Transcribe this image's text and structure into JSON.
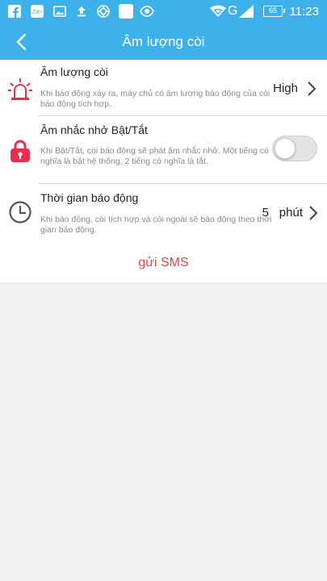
{
  "statusbar": {
    "time": "11:23",
    "battery": "65",
    "network": "G",
    "icons": [
      "facebook-icon",
      "zalo-icon",
      "image-icon",
      "upload-icon",
      "app-icon",
      "square-icon",
      "eye-icon",
      "wifi-icon",
      "signal-icon",
      "battery-icon"
    ]
  },
  "appbar": {
    "title": "Âm lượng còi",
    "back_icon": "back-arrow-icon"
  },
  "settings": {
    "volume": {
      "title": "Âm lượng còi",
      "description": "Khi báo động xảy ra, máy chủ có âm lượng báo động của còi báo động tích hợp.",
      "value": "High",
      "icon": "siren-icon"
    },
    "reminder": {
      "title": "Âm nhắc nhở Bật/Tắt",
      "description": "Khi Bật/Tắt, còi báo động sẽ phát âm nhắc nhở. Một tiếng có nghĩa là bật hệ thống, 2 tiếng có nghĩa là tắt.",
      "enabled": false,
      "icon": "lock-icon"
    },
    "alarm_time": {
      "title": "Thời gian báo động",
      "description": "Khi báo động, còi tích hợp và còi ngoài sẽ báo động theo thời gian báo động.",
      "value": "5",
      "unit": "phút",
      "icon": "clock-icon"
    }
  },
  "sms_label": "gửi SMS",
  "colors": {
    "primary": "#3fb1ea",
    "accent_red": "#e04848",
    "icon_red": "#e8304c"
  }
}
